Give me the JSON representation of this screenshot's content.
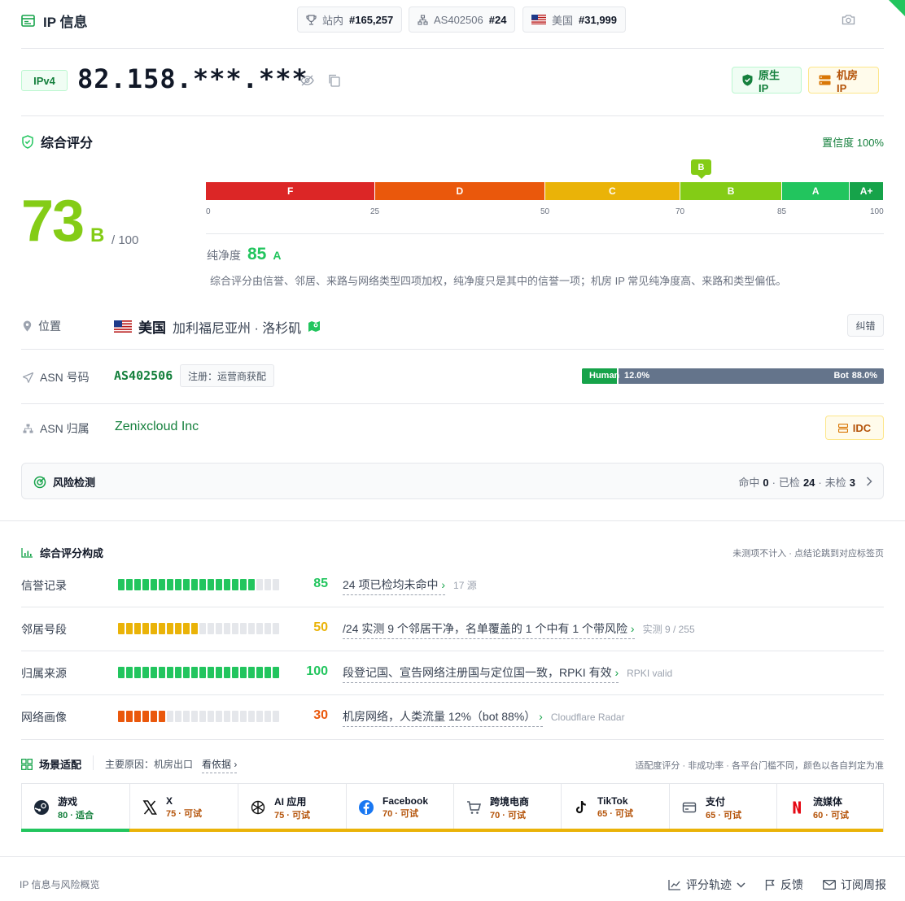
{
  "header": {
    "title": "IP 信息",
    "pills": [
      {
        "label": "站内",
        "value": "#165,257"
      },
      {
        "label": "AS402506",
        "value": "#24"
      },
      {
        "label": "美国",
        "value": "#31,999"
      }
    ]
  },
  "ip": {
    "version": "IPv4",
    "address": "82.158.***.***",
    "tags": [
      "原生 IP",
      "机房 IP"
    ]
  },
  "score": {
    "title": "综合评分",
    "confidence": "置信度 100%",
    "value": "73",
    "grade": "B",
    "max": "/ 100",
    "marker": "B",
    "scale": [
      {
        "grade": "F",
        "from": 0,
        "to": 25,
        "color": "#dc2626"
      },
      {
        "grade": "D",
        "from": 25,
        "to": 50,
        "color": "#ea580c"
      },
      {
        "grade": "C",
        "from": 50,
        "to": 70,
        "color": "#eab308"
      },
      {
        "grade": "B",
        "from": 70,
        "to": 85,
        "color": "#84cc16"
      },
      {
        "grade": "A",
        "from": 85,
        "to": 95,
        "color": "#22c55e"
      },
      {
        "grade": "A+",
        "from": 95,
        "to": 100,
        "color": "#16a34a"
      }
    ],
    "ticks": [
      "0",
      "25",
      "50",
      "70",
      "85",
      "100"
    ],
    "purity_label": "纯净度",
    "purity_value": "85",
    "purity_grade": "A",
    "note": "综合评分由信誉、邻居、来路与网络类型四项加权，纯净度只是其中的信誉一项；机房 IP 常见纯净度高、来路和类型偏低。"
  },
  "location": {
    "label": "位置",
    "country": "美国",
    "region": "加利福尼亚州 · 洛杉矶",
    "correct_btn": "纠错"
  },
  "asn": {
    "label": "ASN 号码",
    "number": "AS402506",
    "reg": "注册：运营商获配",
    "human_label": "Human",
    "human_pct": "12.0%",
    "bot_label": "Bot",
    "bot_pct": "88.0%",
    "human_fraction": 0.12
  },
  "owner": {
    "label": "ASN 归属",
    "name": "Zenixcloud Inc",
    "badge": "IDC"
  },
  "risk": {
    "title": "风险检测",
    "hit_label": "命中",
    "hit": "0",
    "checked_label": "已检",
    "checked": "24",
    "unchecked_label": "未检",
    "unchecked": "3"
  },
  "composition": {
    "title": "综合评分构成",
    "note": "未测项不计入 · 点结论跳到对应标签页",
    "rows": [
      {
        "label": "信誉记录",
        "value": "85",
        "score": 85,
        "color": "#22c55e",
        "desc": "24 项已检均未命中",
        "src": "17 源"
      },
      {
        "label": "邻居号段",
        "value": "50",
        "score": 50,
        "color": "#eab308",
        "desc": "/24 实测 9 个邻居干净，名单覆盖的 1 个中有 1 个带风险",
        "src": "实测 9 / 255"
      },
      {
        "label": "归属来源",
        "value": "100",
        "score": 100,
        "color": "#22c55e",
        "desc": "段登记国、宣告网络注册国与定位国一致，RPKI 有效",
        "src": "RPKI valid"
      },
      {
        "label": "网络画像",
        "value": "30",
        "score": 30,
        "color": "#ea580c",
        "desc": "机房网络，人类流量 12%（bot 88%）",
        "src": "Cloudflare Radar"
      }
    ]
  },
  "scenes": {
    "title": "场景适配",
    "reason": "主要原因：机房出口",
    "evidence": "看依据",
    "note": "适配度评分 · 非成功率 · 各平台门槛不同，颜色以各自判定为准",
    "items": [
      {
        "name": "游戏",
        "score": "80 · 适合",
        "icon": "steam-icon",
        "good": true
      },
      {
        "name": "X",
        "score": "75 · 可试",
        "icon": "x-icon",
        "good": false
      },
      {
        "name": "AI 应用",
        "score": "75 · 可试",
        "icon": "openai-icon",
        "good": false
      },
      {
        "name": "Facebook",
        "score": "70 · 可试",
        "icon": "facebook-icon",
        "good": false
      },
      {
        "name": "跨境电商",
        "score": "70 · 可试",
        "icon": "cart-icon",
        "good": false
      },
      {
        "name": "TikTok",
        "score": "65 · 可试",
        "icon": "tiktok-icon",
        "good": false
      },
      {
        "name": "支付",
        "score": "65 · 可试",
        "icon": "card-icon",
        "good": false
      },
      {
        "name": "流媒体",
        "score": "60 · 可试",
        "icon": "netflix-icon",
        "good": false
      }
    ]
  },
  "footer": {
    "left": "IP 信息与风险概览",
    "trend": "评分轨迹",
    "feedback": "反馈",
    "subscribe": "订阅周报"
  }
}
